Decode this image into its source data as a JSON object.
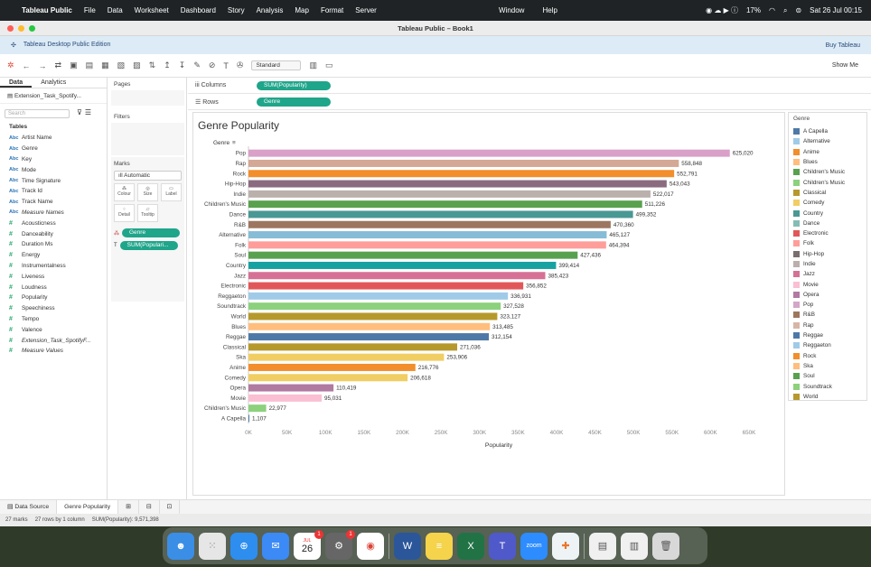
{
  "menubar": {
    "app": "Tableau Public",
    "items": [
      "File",
      "Data",
      "Worksheet",
      "Dashboard",
      "Story",
      "Analysis",
      "Map",
      "Format",
      "Server"
    ],
    "center": [
      "Window",
      "Help"
    ],
    "battery": "17%",
    "datetime": "Sat 26 Jul  00:15"
  },
  "window": {
    "title": "Tableau Public – Book1"
  },
  "banner": {
    "edition": "Tableau Desktop Public Edition",
    "buy": "Buy Tableau"
  },
  "toolbar": {
    "fit": "Standard",
    "show_me": "Show Me"
  },
  "left_panel": {
    "tabs": [
      "Data",
      "Analytics"
    ],
    "datasource": "Extension_Task_Spotify...",
    "search_placeholder": "Search",
    "tables_label": "Tables",
    "dimensions": [
      {
        "type": "Abc",
        "name": "Artist Name"
      },
      {
        "type": "Abc",
        "name": "Genre"
      },
      {
        "type": "Abc",
        "name": "Key"
      },
      {
        "type": "Abc",
        "name": "Mode"
      },
      {
        "type": "Abc",
        "name": "Time Signature"
      },
      {
        "type": "Abc",
        "name": "Track Id"
      },
      {
        "type": "Abc",
        "name": "Track Name"
      },
      {
        "type": "Abc",
        "name": "Measure Names"
      }
    ],
    "measures": [
      {
        "type": "#",
        "name": "Acousticness"
      },
      {
        "type": "#",
        "name": "Danceability"
      },
      {
        "type": "#",
        "name": "Duration Ms"
      },
      {
        "type": "#",
        "name": "Energy"
      },
      {
        "type": "#",
        "name": "Instrumentalness"
      },
      {
        "type": "#",
        "name": "Liveness"
      },
      {
        "type": "#",
        "name": "Loudness"
      },
      {
        "type": "#",
        "name": "Popularity"
      },
      {
        "type": "#",
        "name": "Speechiness"
      },
      {
        "type": "#",
        "name": "Tempo"
      },
      {
        "type": "#",
        "name": "Valence"
      },
      {
        "type": "#",
        "name": "Extension_Task_SpotifyF..."
      },
      {
        "type": "#",
        "name": "Measure Values"
      }
    ]
  },
  "cards": {
    "pages": "Pages",
    "filters": "Filters",
    "marks": "Marks",
    "mark_type": "Automatic",
    "mark_buttons": [
      "Colour",
      "Size",
      "Label",
      "Detail",
      "Tooltip"
    ],
    "mark_pills": [
      "Genre",
      "SUM(Populari..."
    ]
  },
  "shelves": {
    "columns_label": "Columns",
    "columns_pill": "SUM(Popularity)",
    "rows_label": "Rows",
    "rows_pill": "Genre"
  },
  "sheet": {
    "title": "Genre Popularity",
    "row_header": "Genre"
  },
  "chart_data": {
    "type": "bar",
    "title": "Genre Popularity",
    "xlabel": "Popularity",
    "ylabel": "Genre",
    "xlim": [
      0,
      650000
    ],
    "xticks": [
      "0K",
      "50K",
      "100K",
      "150K",
      "200K",
      "250K",
      "300K",
      "350K",
      "400K",
      "450K",
      "500K",
      "550K",
      "600K",
      "650K"
    ],
    "categories": [
      "Pop",
      "Rap",
      "Rock",
      "Hip-Hop",
      "Indie",
      "Children's Music",
      "Dance",
      "R&B",
      "Alternative",
      "Folk",
      "Soul",
      "Country",
      "Jazz",
      "Electronic",
      "Reggaeton",
      "Soundtrack",
      "World",
      "Blues",
      "Reggae",
      "Classical",
      "Ska",
      "Anime",
      "Comedy",
      "Opera",
      "Movie",
      "Children's Music",
      "A Capella"
    ],
    "values": [
      625020,
      558848,
      552791,
      543043,
      522017,
      511226,
      499352,
      470360,
      465127,
      464394,
      427436,
      399414,
      385423,
      356852,
      336931,
      327528,
      323127,
      313485,
      312154,
      271036,
      253906,
      216776,
      206618,
      110419,
      95031,
      22977,
      1107
    ],
    "labels": [
      "625,020",
      "558,848",
      "552,791",
      "543,043",
      "522,017",
      "511,226",
      "499,352",
      "470,360",
      "465,127",
      "464,394",
      "427,436",
      "399,414",
      "385,423",
      "356,852",
      "336,931",
      "327,528",
      "323,127",
      "313,485",
      "312,154",
      "271,036",
      "253,906",
      "216,776",
      "206,618",
      "110,419",
      "95,031",
      "22,977",
      "1,107"
    ],
    "colors": [
      "#d9a0c8",
      "#d3a894",
      "#f28e2b",
      "#8a6b7f",
      "#bab0ac",
      "#59a14f",
      "#499894",
      "#9d7660",
      "#86bcd6",
      "#ff9d9a",
      "#59a14f",
      "#17a2a2",
      "#d67195",
      "#e15759",
      "#a0cbe8",
      "#8cd17d",
      "#b6992d",
      "#ffbe7d",
      "#4e79a7",
      "#b6992d",
      "#f1ce63",
      "#f28e2b",
      "#f1ce63",
      "#b07aa1",
      "#fabfd2",
      "#8cd17d",
      "#4e79a7"
    ]
  },
  "legend": {
    "title": "Genre",
    "items": [
      {
        "name": "A Capella",
        "color": "#4e79a7"
      },
      {
        "name": "Alternative",
        "color": "#a0cbe8"
      },
      {
        "name": "Anime",
        "color": "#f28e2b"
      },
      {
        "name": "Blues",
        "color": "#ffbe7d"
      },
      {
        "name": "Children's Music",
        "color": "#59a14f"
      },
      {
        "name": "Children's Music",
        "color": "#8cd17d"
      },
      {
        "name": "Classical",
        "color": "#b6992d"
      },
      {
        "name": "Comedy",
        "color": "#f1ce63"
      },
      {
        "name": "Country",
        "color": "#499894"
      },
      {
        "name": "Dance",
        "color": "#86bcb6"
      },
      {
        "name": "Electronic",
        "color": "#e15759"
      },
      {
        "name": "Folk",
        "color": "#ff9d9a"
      },
      {
        "name": "Hip-Hop",
        "color": "#79706e"
      },
      {
        "name": "Indie",
        "color": "#bab0ac"
      },
      {
        "name": "Jazz",
        "color": "#d37295"
      },
      {
        "name": "Movie",
        "color": "#fabfd2"
      },
      {
        "name": "Opera",
        "color": "#b07aa1"
      },
      {
        "name": "Pop",
        "color": "#d4a6c8"
      },
      {
        "name": "R&B",
        "color": "#9d7660"
      },
      {
        "name": "Rap",
        "color": "#d7b5a6"
      },
      {
        "name": "Reggae",
        "color": "#4e79a7"
      },
      {
        "name": "Reggaeton",
        "color": "#a0cbe8"
      },
      {
        "name": "Rock",
        "color": "#f28e2b"
      },
      {
        "name": "Ska",
        "color": "#ffbe7d"
      },
      {
        "name": "Soul",
        "color": "#59a14f"
      },
      {
        "name": "Soundtrack",
        "color": "#8cd17d"
      },
      {
        "name": "World",
        "color": "#b6992d"
      }
    ]
  },
  "bottom_tabs": [
    "Data Source",
    "Genre Popularity"
  ],
  "status": {
    "marks": "27 marks",
    "rows": "27 rows by 1 column",
    "sum": "SUM(Popularity): 9,571,398"
  },
  "dock": {
    "calendar_month": "JUL",
    "calendar_day": "26",
    "zoom": "zoom"
  }
}
